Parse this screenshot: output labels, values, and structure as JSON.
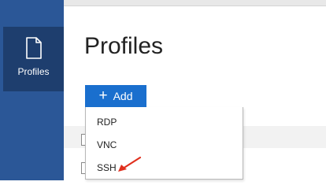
{
  "sidebar": {
    "items": [
      {
        "label": "Profiles",
        "icon": "document-icon",
        "selected": true
      }
    ],
    "colors": {
      "background": "#2b5797",
      "selected": "#1e3e6e"
    }
  },
  "main": {
    "title": "Profiles",
    "add_button": {
      "label": "Add",
      "icon": "plus-icon",
      "color": "#1a6fce"
    }
  },
  "dropdown": {
    "items": [
      {
        "label": "RDP"
      },
      {
        "label": "VNC"
      },
      {
        "label": "SSH",
        "annotated": true
      }
    ]
  },
  "annotation": {
    "type": "arrow",
    "color": "#e0301e"
  }
}
